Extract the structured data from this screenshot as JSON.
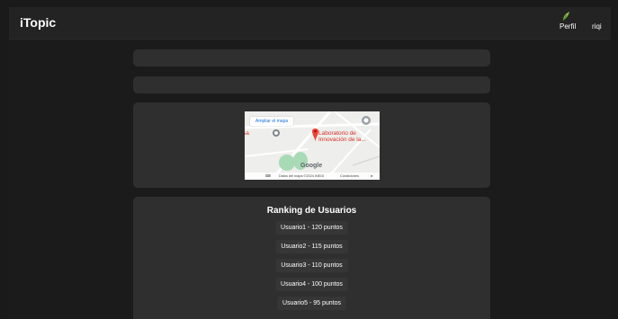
{
  "header": {
    "brand": "iTopic",
    "profile_label": "Perfil",
    "username": "riqi"
  },
  "map": {
    "enlarge_label": "Ampliar el mapa",
    "place_label": "Laboratorio de Innovación de la...",
    "cut_label": "sa",
    "google_logo": "Google",
    "keyboard_label": "⌨",
    "attribution": "Datos del mapa ©2024 INEGI",
    "terms": "Condiciones",
    "report_icon": "●"
  },
  "ranking": {
    "title": "Ranking de Usuarios",
    "items": [
      "Usuario1 - 120 puntos",
      "Usuario2 - 115 puntos",
      "Usuario3 - 110 puntos",
      "Usuario4 - 100 puntos",
      "Usuario5 - 95 puntos"
    ]
  },
  "colors": {
    "background": "#1b1b1b",
    "card": "#2f2f2f",
    "rank_item": "#363636",
    "map_pin": "#d93025"
  }
}
